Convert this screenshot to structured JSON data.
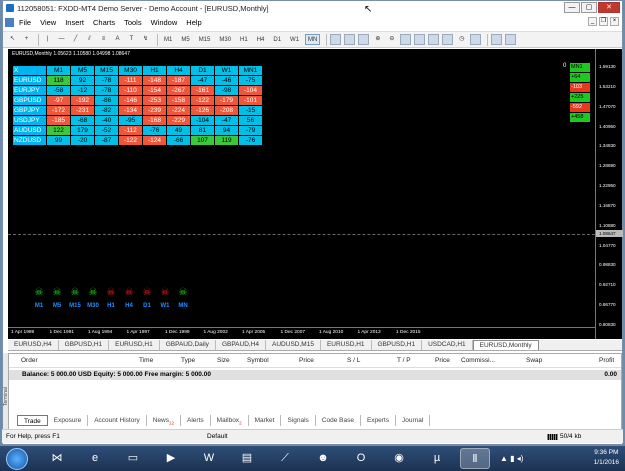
{
  "window": {
    "title": "112058051: FXDD-MT4 Demo Server - Demo Account - [EURUSD,Monthly]",
    "buttons": [
      "—",
      "▢",
      "✕"
    ]
  },
  "menu": [
    "File",
    "View",
    "Insert",
    "Charts",
    "Tools",
    "Window",
    "Help"
  ],
  "mdi_buttons": [
    "_",
    "❐",
    "×"
  ],
  "timeframes": [
    "M1",
    "M5",
    "M15",
    "M30",
    "H1",
    "H4",
    "D1",
    "W1",
    "MN"
  ],
  "active_timeframe": "MN",
  "chart": {
    "title": "EURUSD,Monthly  1.05623 1.10580 1.04998 1.08647",
    "price_labels": [
      "1.59130",
      "1.53210",
      "1.47070",
      "1.40950",
      "1.34830",
      "1.28890",
      "1.22950",
      "1.16870",
      "1.10880",
      "1.04770",
      "0.98830",
      "0.92710",
      "0.86770",
      "0.80830"
    ],
    "current_price": "1.08647",
    "time_labels": [
      "1 Apr 1989",
      "1 Dec 1991",
      "1 Aug 1994",
      "1 Apr 1997",
      "1 Dec 1999",
      "1 Aug 2002",
      "1 Apr 2005",
      "1 Dec 2007",
      "1 Aug 2010",
      "1 Apr 2013",
      "1 Dec 2015"
    ],
    "matrix": {
      "header": [
        "X",
        "M1",
        "M5",
        "M15",
        "M30",
        "H1",
        "H4",
        "D1",
        "W1",
        "MN1"
      ],
      "rows": [
        {
          "pair": "EURUSD",
          "values": [
            "118",
            "92",
            "-78",
            "-111",
            "-148",
            "-187",
            "-47",
            "-46",
            "-75"
          ]
        },
        {
          "pair": "EURJPY",
          "values": [
            "-58",
            "-12",
            "-78",
            "-110",
            "-154",
            "-267",
            "-161",
            "-98",
            "-104"
          ]
        },
        {
          "pair": "GBPUSD",
          "values": [
            "-97",
            "-192",
            "-86",
            "-146",
            "-253",
            "-158",
            "-122",
            "-179",
            "-101"
          ]
        },
        {
          "pair": "GBPJPY",
          "values": [
            "-172",
            "-231",
            "-82",
            "-134",
            "-239",
            "-224",
            "-126",
            "-208",
            "-15"
          ]
        },
        {
          "pair": "USDJPY",
          "values": [
            "-185",
            "-68",
            "-40",
            "-95",
            "-168",
            "-229",
            "-104",
            "-47",
            "56"
          ]
        },
        {
          "pair": "AUDUSD",
          "values": [
            "122",
            "179",
            "-52",
            "-112",
            "-76",
            "49",
            "81",
            "94",
            "-79"
          ]
        },
        {
          "pair": "NZDUSD",
          "values": [
            "99",
            "-20",
            "-87",
            "-122",
            "-124",
            "-66",
            "107",
            "119",
            "-76"
          ]
        }
      ],
      "cell_colors": [
        [
          "green",
          "hdr",
          "hdr",
          "red",
          "red",
          "red",
          "hdr",
          "hdr",
          "hdr"
        ],
        [
          "hdr",
          "hdr",
          "hdr",
          "red",
          "red",
          "red",
          "red",
          "hdr",
          "red"
        ],
        [
          "red",
          "red",
          "hdr",
          "red",
          "red",
          "red",
          "red",
          "red",
          "red"
        ],
        [
          "red",
          "red",
          "hdr",
          "red",
          "red",
          "red",
          "red",
          "red",
          "hdr"
        ],
        [
          "red",
          "hdr",
          "hdr",
          "hdr",
          "red",
          "red",
          "hdr",
          "hdr",
          "hdr"
        ],
        [
          "green",
          "hdr",
          "hdr",
          "red",
          "hdr",
          "hdr",
          "hdr",
          "hdr",
          "hdr"
        ],
        [
          "hdr",
          "hdr",
          "hdr",
          "red",
          "red",
          "hdr",
          "green",
          "green",
          "hdr"
        ]
      ]
    },
    "signal_zero": "0",
    "signals": [
      {
        "text": "MN1",
        "color": "g"
      },
      {
        "text": "+64",
        "color": "g"
      },
      {
        "text": "-103",
        "color": "r"
      },
      {
        "text": "+225",
        "color": "g"
      },
      {
        "text": "-592",
        "color": "r"
      },
      {
        "text": "+458",
        "color": "g"
      }
    ],
    "skulls": [
      {
        "label": "M1",
        "color": "#22dd22"
      },
      {
        "label": "M5",
        "color": "#22dd22"
      },
      {
        "label": "M15",
        "color": "#22dd22"
      },
      {
        "label": "M30",
        "color": "#22dd22"
      },
      {
        "label": "H1",
        "color": "#ee2222"
      },
      {
        "label": "H4",
        "color": "#ee2222"
      },
      {
        "label": "D1",
        "color": "#ee2222"
      },
      {
        "label": "W1",
        "color": "#ee2222"
      },
      {
        "label": "MN",
        "color": "#22dd22"
      }
    ]
  },
  "chart_tabs": [
    "EURUSD,H4",
    "GBPUSD,H1",
    "EURUSD,H1",
    "GBPAUD,Daily",
    "GBPAUD,H4",
    "AUDUSD,M15",
    "EURUSD,H1",
    "GBPUSD,H1",
    "USDCAD,H1",
    "EURUSD,Monthly"
  ],
  "active_chart_tab": "EURUSD,Monthly",
  "terminal": {
    "columns": [
      "Order",
      "Time",
      "Type",
      "Size",
      "Symbol",
      "Price",
      "S / L",
      "T / P",
      "Price",
      "Commissi...",
      "Swap",
      "Profit"
    ],
    "balance_text": "Balance: 5 000.00 USD  Equity: 5 000.00  Free margin: 5 000.00",
    "balance_profit": "0.00",
    "side_label": "Terminal",
    "tabs": [
      "Trade",
      "Exposure",
      "Account History",
      "News",
      "Alerts",
      "Mailbox",
      "Market",
      "Signals",
      "Code Base",
      "Experts",
      "Journal"
    ],
    "news_badge": "12",
    "mailbox_badge": "2",
    "active_tab": "Trade"
  },
  "status": {
    "help": "For Help, press F1",
    "profile": "Default",
    "traffic": "50/4 kb"
  },
  "taskbar": {
    "time": "9:36 PM",
    "date": "1/1/2016"
  }
}
